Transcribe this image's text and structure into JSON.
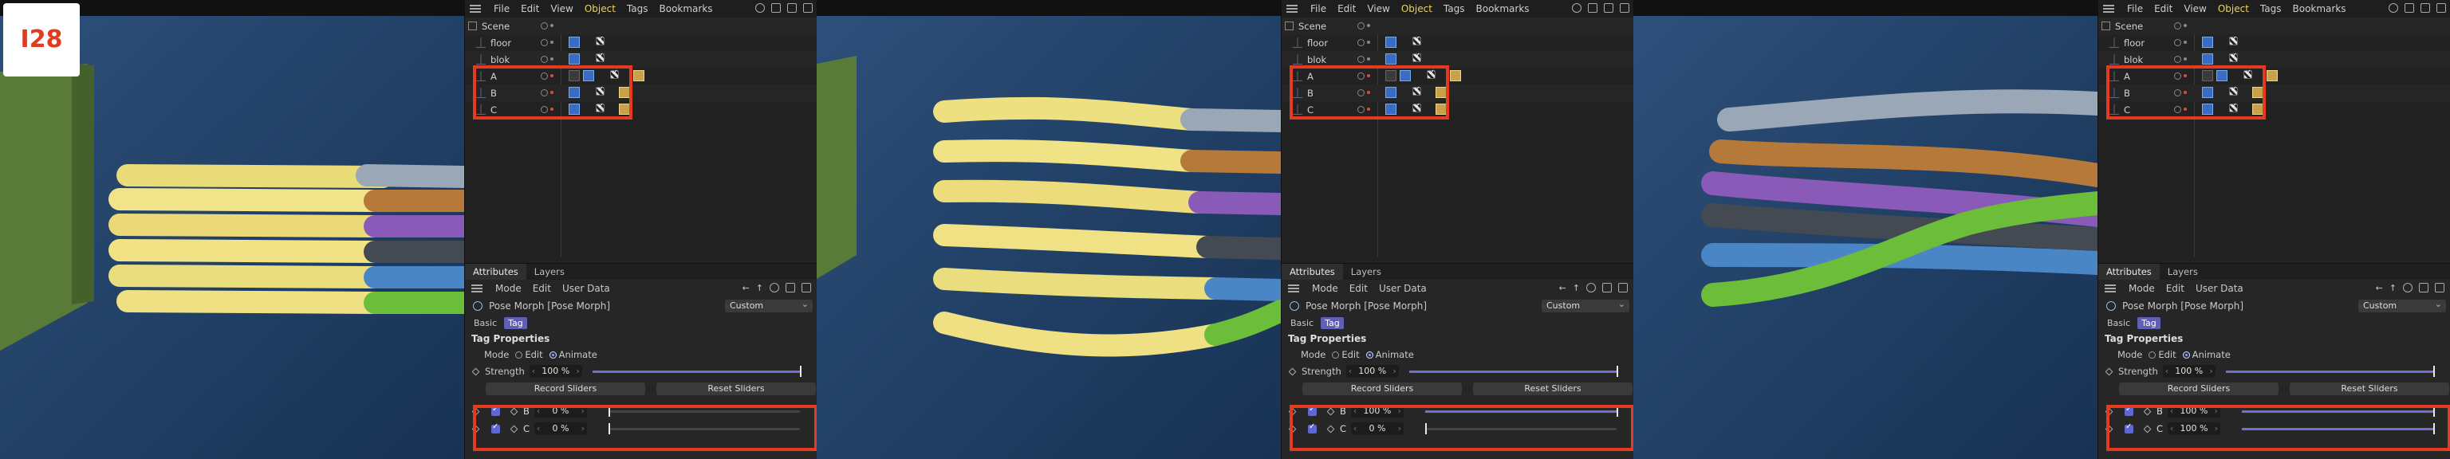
{
  "badge": "I28",
  "menu": [
    "File",
    "Edit",
    "View",
    "Object",
    "Tags",
    "Bookmarks"
  ],
  "active_menu": "Object",
  "objects": [
    {
      "name": "Scene"
    },
    {
      "name": "floor"
    },
    {
      "name": "blok"
    },
    {
      "name": "A"
    },
    {
      "name": "B"
    },
    {
      "name": "C"
    }
  ],
  "attributes": {
    "tabs": [
      "Attributes",
      "Layers"
    ],
    "menu": [
      "Mode",
      "Edit",
      "User Data"
    ],
    "title": "Pose Morph [Pose Morph]",
    "dropdown": "Custom",
    "subtabs": [
      "Basic",
      "Tag"
    ],
    "section": "Tag Properties",
    "mode_label": "Mode",
    "mode_edit": "Edit",
    "mode_animate": "Animate",
    "strength_label": "Strength",
    "strength_value": "100 %",
    "strength_level": 1.0,
    "record_btn": "Record Sliders",
    "reset_btn": "Reset Sliders",
    "target_b": "B",
    "target_c": "C"
  },
  "panels": [
    {
      "b_value": "0 %",
      "c_value": "0 %",
      "b_level": 0.0,
      "c_level": 0.0
    },
    {
      "b_value": "100 %",
      "c_value": "0 %",
      "b_level": 1.0,
      "c_level": 0.0
    },
    {
      "b_value": "100 %",
      "c_value": "100 %",
      "b_level": 1.0,
      "c_level": 1.0
    }
  ],
  "colors": {
    "highlight": "#e43a1f",
    "accent": "#6066d6"
  }
}
